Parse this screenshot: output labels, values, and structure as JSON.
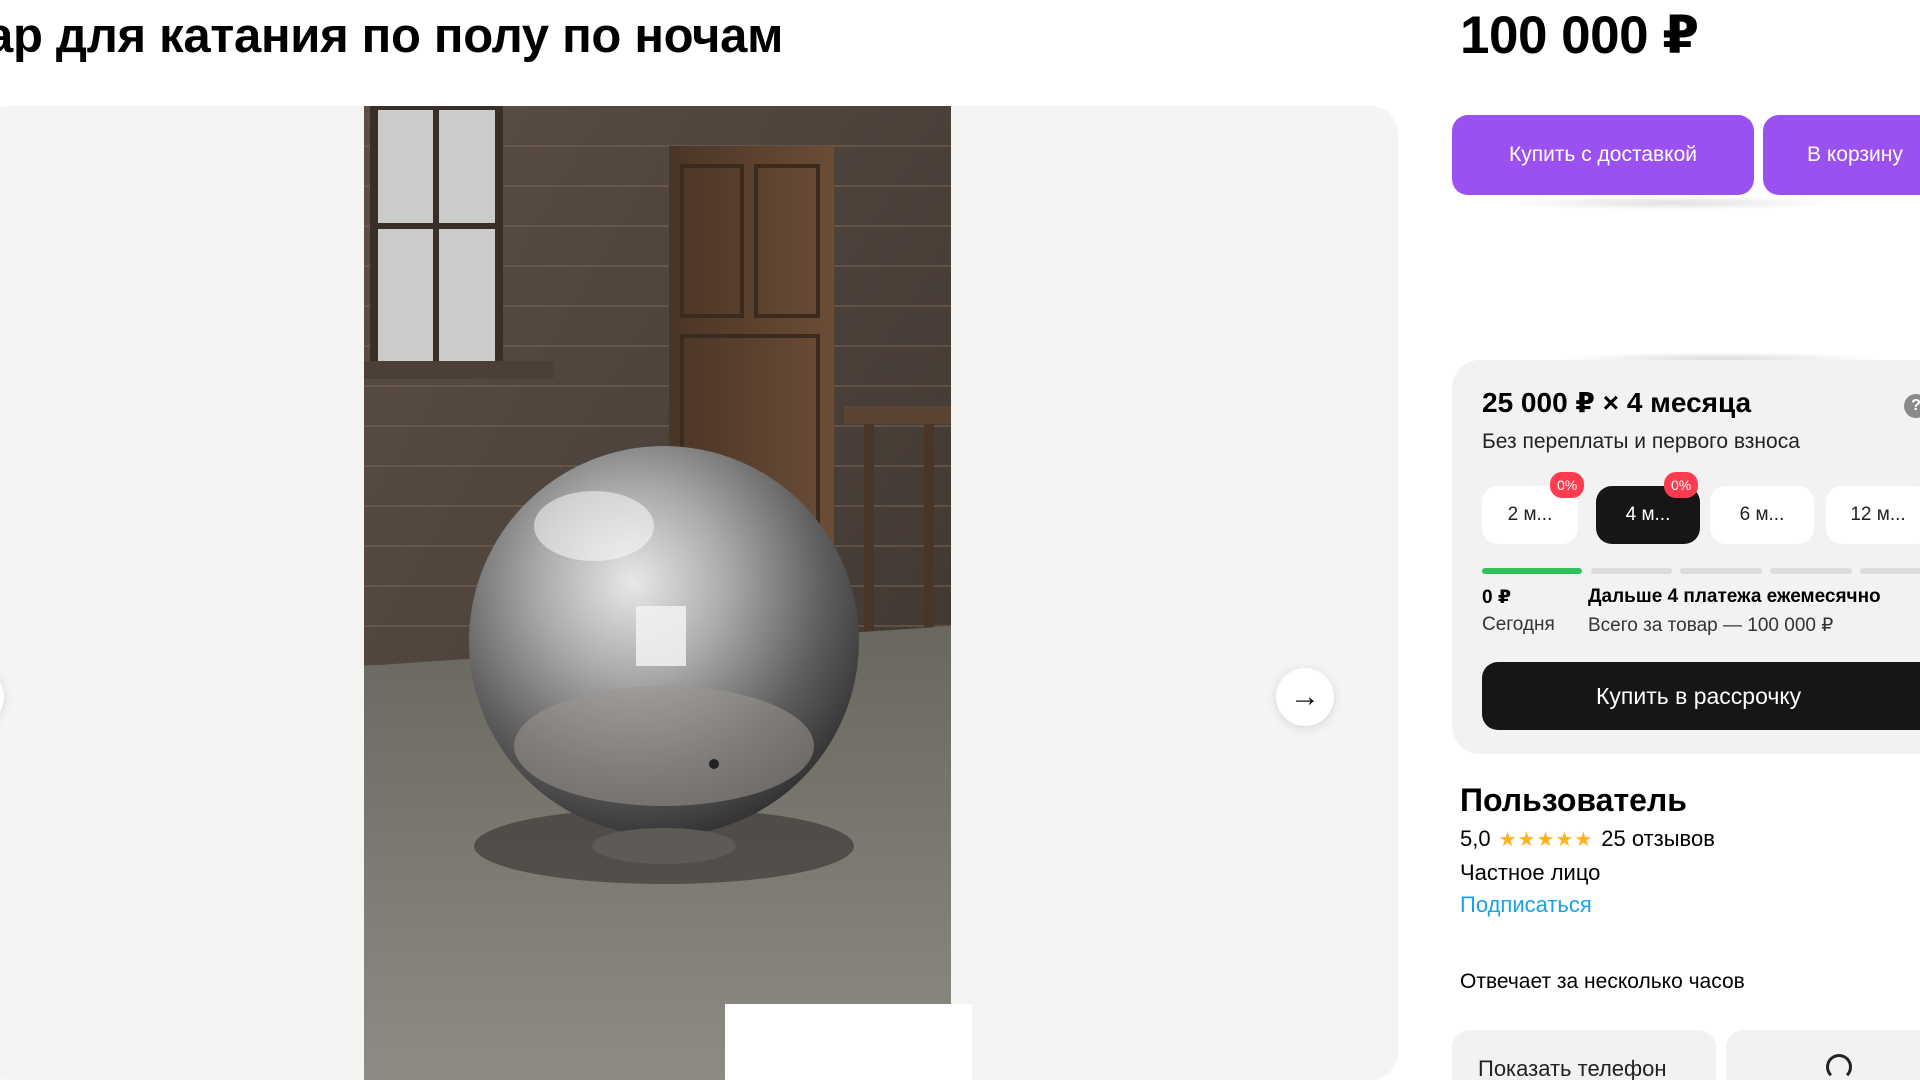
{
  "listing": {
    "title": "ар для катания по полу по ночам",
    "price": "100 000 ₽"
  },
  "gallery": {
    "prev_icon": "←",
    "next_icon": "→"
  },
  "actions": {
    "buy_delivery": "Купить с доставкой",
    "add_to_cart": "В корзину"
  },
  "installment": {
    "headline": "25 000 ₽ × 4 месяца",
    "subtitle": "Без переплаты и первого взноса",
    "help_icon": "?",
    "terms": [
      {
        "label": "2 м...",
        "badge": "0%",
        "active": false
      },
      {
        "label": "4 м...",
        "badge": "0%",
        "active": true
      },
      {
        "label": "6 м...",
        "active": false
      },
      {
        "label": "12 м...",
        "active": false
      }
    ],
    "today_amount": "0 ₽",
    "today_label": "Сегодня",
    "next_payments": "Дальше 4 платежа ежемесячно",
    "total": "Всего за товар — 100 000 ₽",
    "buy_button": "Купить в рассрочку",
    "progress_segments_done": 1,
    "progress_segments_total": 5
  },
  "seller": {
    "name": "Пользователь",
    "rating": "5,0",
    "stars": "★★★★★",
    "rating_value": 5,
    "reviews": "25 отзывов",
    "type": "Частное лицо",
    "subscribe": "Подписаться",
    "response_time": "Отвечает за несколько часов"
  },
  "contact": {
    "show_phone": "Показать телефон"
  },
  "colors": {
    "accent_purple": "#9b51f2",
    "dark_button": "#161616",
    "badge_red": "#ff3c4f",
    "progress_green": "#2fc35a",
    "link_blue": "#1aa1e6",
    "star_yellow": "#ffb21e"
  }
}
